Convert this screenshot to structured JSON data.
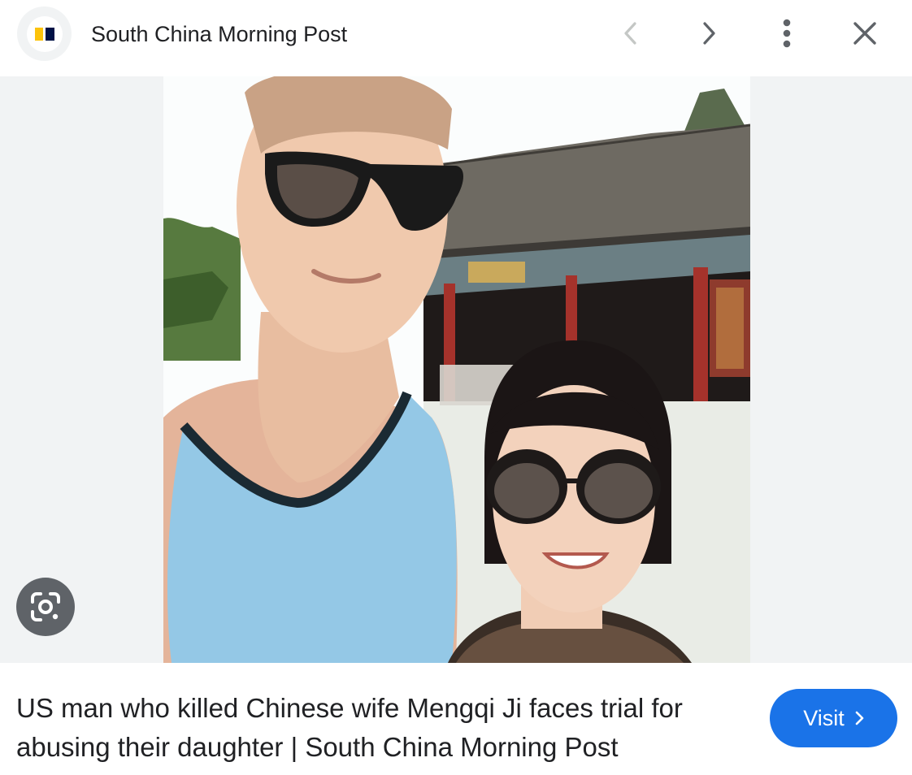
{
  "header": {
    "site_name": "South China Morning Post",
    "favicon_icon": "scmp-logo-icon",
    "prev_icon": "chevron-left-icon",
    "next_icon": "chevron-right-icon",
    "more_icon": "more-vert-icon",
    "close_icon": "close-icon"
  },
  "image": {
    "lens_icon": "google-lens-icon"
  },
  "result": {
    "title": "US man who killed Chinese wife Mengqi Ji faces trial for abusing their daughter | South China Morning Post",
    "visit_label": "Visit",
    "visit_icon": "chevron-right-icon"
  },
  "colors": {
    "accent": "#1a73e8",
    "logo_yellow": "#fcc30b",
    "logo_navy": "#001246",
    "backdrop": "#f1f3f4",
    "text": "#202124"
  }
}
